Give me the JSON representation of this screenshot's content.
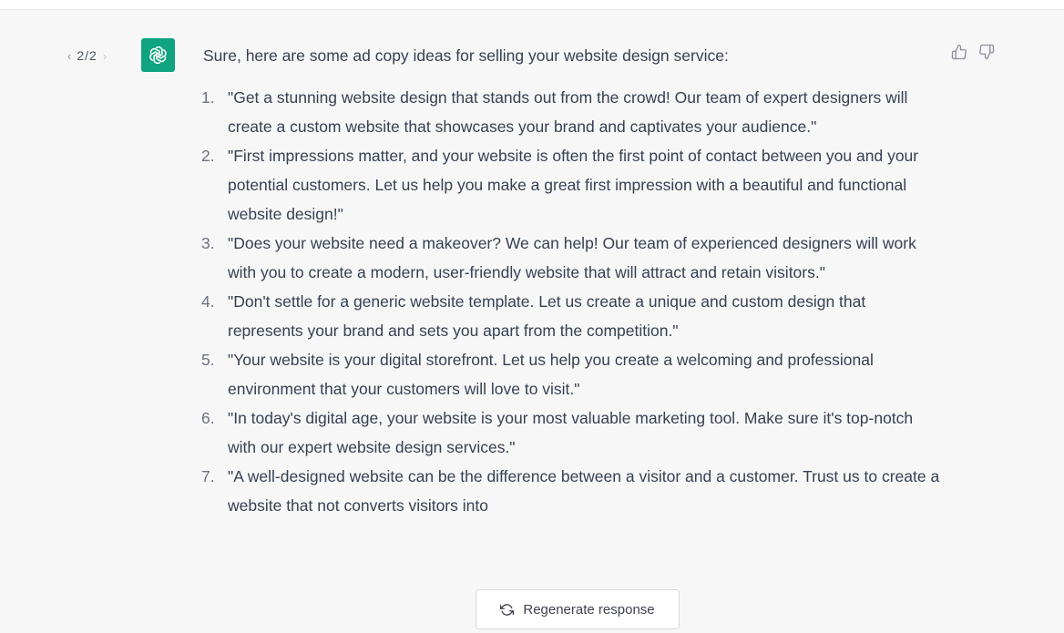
{
  "pager": {
    "prev": "‹",
    "count": "2/2",
    "next": "›"
  },
  "message": {
    "intro": "Sure, here are some ad copy ideas for selling your website design service:",
    "items": [
      {
        "num": "1.",
        "text": "\"Get a stunning website design that stands out from the crowd! Our team of expert designers will create a custom website that showcases your brand and captivates your audience.\""
      },
      {
        "num": "2.",
        "text": "\"First impressions matter, and your website is often the first point of contact between you and your potential customers. Let us help you make a great first impression with a beautiful and functional website design!\""
      },
      {
        "num": "3.",
        "text": "\"Does your website need a makeover? We can help! Our team of experienced designers will work with you to create a modern, user-friendly website that will attract and retain visitors.\""
      },
      {
        "num": "4.",
        "text": "\"Don't settle for a generic website template. Let us create a unique and custom design that represents your brand and sets you apart from the competition.\""
      },
      {
        "num": "5.",
        "text": "\"Your website is your digital storefront. Let us help you create a welcoming and professional environment that your customers will love to visit.\""
      },
      {
        "num": "6.",
        "text": "\"In today's digital age, your website is your most valuable marketing tool. Make sure it's top-notch with our expert website design services.\""
      },
      {
        "num": "7.",
        "text": "\"A well-designed website can be the difference between a visitor and a customer. Trust us to create a website that not converts visitors into"
      }
    ]
  },
  "regenerate": {
    "label": "Regenerate response"
  },
  "icons": {
    "avatar": "openai-logo-icon",
    "thumbs_up": "thumbs-up-icon",
    "thumbs_down": "thumbs-down-icon",
    "regenerate": "refresh-icon"
  },
  "colors": {
    "brand": "#10a37f",
    "background": "#f7f7f8",
    "text": "#374151"
  }
}
